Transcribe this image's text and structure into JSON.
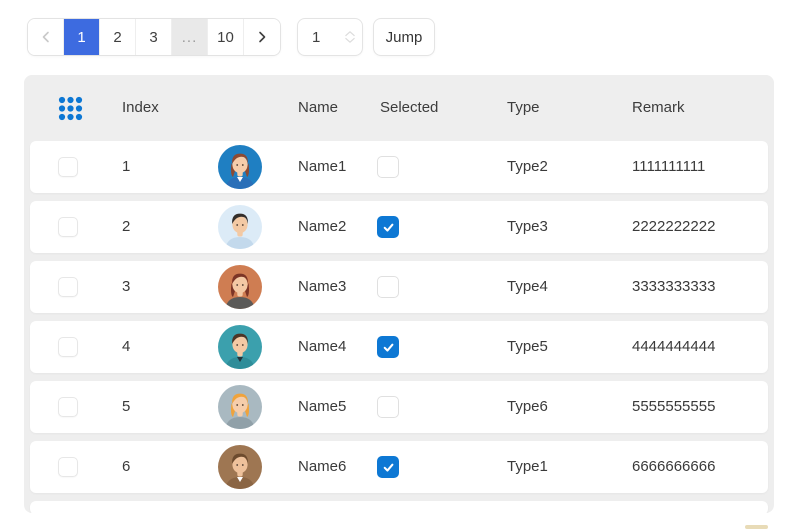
{
  "colors": {
    "active_page_blue": "#3D6BE0",
    "check_blue": "#0D78D4",
    "grid_dot_blue": "#0C77D4",
    "table_bg_gray": "#eeeeee",
    "disabled_chevron": "#c9c9c9",
    "chevron_dark": "#3f3f3f"
  },
  "pagination": {
    "prev_icon": "chevron-left",
    "next_icon": "chevron-right",
    "pages": [
      "1",
      "2",
      "3",
      "...",
      "10"
    ],
    "active_page": "1",
    "jump_input_value": "1",
    "jump_label": "Jump"
  },
  "table": {
    "columns": [
      "Index",
      "Name",
      "Selected",
      "Type",
      "Remark"
    ],
    "rows": [
      {
        "index": "1",
        "name": "Name1",
        "selected": false,
        "type": "Type2",
        "remark": "1111111111",
        "avatar": {
          "label": "avatar-woman-blue",
          "bg": "#1F7FC2",
          "skin": "#F6CDAA",
          "hair": "#8C4A33",
          "shirt": "#2A6FB8",
          "collar": "#FFFFFF",
          "hair_long": true
        }
      },
      {
        "index": "2",
        "name": "Name2",
        "selected": true,
        "type": "Type3",
        "remark": "2222222222",
        "avatar": {
          "label": "avatar-man-lightblue",
          "bg": "#DCEBF7",
          "skin": "#F3C9A4",
          "hair": "#332E2B",
          "shirt": "#C3D9EC",
          "collar": null,
          "hair_long": false
        }
      },
      {
        "index": "3",
        "name": "Name3",
        "selected": false,
        "type": "Type4",
        "remark": "3333333333",
        "avatar": {
          "label": "avatar-woman-coral",
          "bg": "#CF7D52",
          "skin": "#F3C9A4",
          "hair": "#7C3526",
          "shirt": "#5B5A58",
          "collar": null,
          "hair_long": true
        }
      },
      {
        "index": "4",
        "name": "Name4",
        "selected": true,
        "type": "Type5",
        "remark": "4444444444",
        "avatar": {
          "label": "avatar-man-teal",
          "bg": "#3BA0AD",
          "skin": "#F3C9A4",
          "hair": "#4D3526",
          "shirt": "#2F8D99",
          "collar": "#24333B",
          "hair_long": false
        }
      },
      {
        "index": "5",
        "name": "Name5",
        "selected": false,
        "type": "Type6",
        "remark": "5555555555",
        "avatar": {
          "label": "avatar-person-gray",
          "bg": "#A9B9C1",
          "skin": "#F6CDAA",
          "hair": "#EFA33C",
          "shirt": "#90A0A8",
          "collar": null,
          "hair_long": true
        }
      },
      {
        "index": "6",
        "name": "Name6",
        "selected": true,
        "type": "Type1",
        "remark": "6666666666",
        "avatar": {
          "label": "avatar-man-brown",
          "bg": "#9E7652",
          "skin": "#EEC19B",
          "hair": "#6D4B2E",
          "shirt": "#8A6544",
          "collar": "#FFFFFF",
          "hair_long": false
        }
      }
    ]
  }
}
